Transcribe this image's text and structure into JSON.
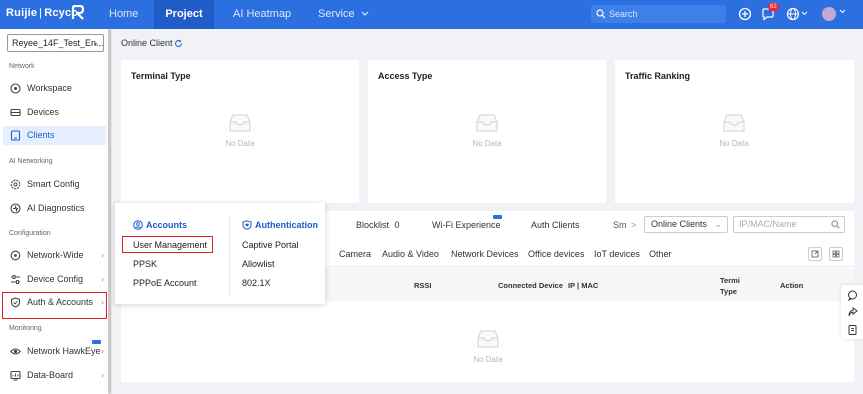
{
  "brand": {
    "name": "Ruijie",
    "separator": "|",
    "sub": "Rcycc"
  },
  "nav": {
    "home": "Home",
    "project": "Project",
    "heatmap": "AI Heatmap",
    "service": "Service"
  },
  "search": {
    "placeholder": "Search"
  },
  "notifications": {
    "count": "62"
  },
  "sidebar": {
    "project": "Reyee_14F_Test_En...",
    "sections": {
      "network": "Network",
      "ai_networking": "AI Networking",
      "configuration": "Configuration",
      "monitoring": "Monitoring"
    },
    "items": {
      "workspace": "Workspace",
      "devices": "Devices",
      "clients": "Clients",
      "smart_config": "Smart Config",
      "ai_diagnostics": "AI Diagnostics",
      "network_wide": "Network-Wide",
      "device_config": "Device Config",
      "auth_accounts": "Auth & Accounts",
      "network_hawkeye": "Network HawkEye",
      "data_board": "Data-Board"
    }
  },
  "main": {
    "title": "Online Client",
    "cards": {
      "terminal_type": "Terminal Type",
      "access_type": "Access Type",
      "traffic_ranking": "Traffic Ranking"
    },
    "no_data": "No Data",
    "tabs": {
      "blocklist": "Blocklist",
      "blocklist_count": "0",
      "wifi_experience": "Wi-Fi Experience",
      "auth_clients": "Auth Clients",
      "sm": "Sm",
      "more": ">"
    },
    "filter": {
      "selected": "Online Clients",
      "search_placeholder": "IP/MAC/Name"
    },
    "categories": {
      "camera": "Camera",
      "audio_video": "Audio & Video",
      "network_devices": "Network Devices",
      "office_devices": "Office devices",
      "iot_devices": "IoT devices",
      "other": "Other"
    },
    "columns": {
      "rssi": "RSSI",
      "connected_device": "Connected Device",
      "ip_mac": "IP | MAC",
      "terminal_l1": "Termi",
      "terminal_l2": "Type",
      "action": "Action"
    }
  },
  "popup": {
    "accounts_header": "Accounts",
    "auth_header": "Authentication",
    "user_management": "User Management",
    "ppsk": "PPSK",
    "pppoe": "PPPoE Account",
    "captive_portal": "Captive Portal",
    "allowlist": "Allowlist",
    "dot1x": "802.1X"
  },
  "colors": {
    "brand": "#2b6fe0",
    "accent": "#1f5cc7",
    "highlight_box": "#e02020",
    "badge": "#f5222d"
  }
}
